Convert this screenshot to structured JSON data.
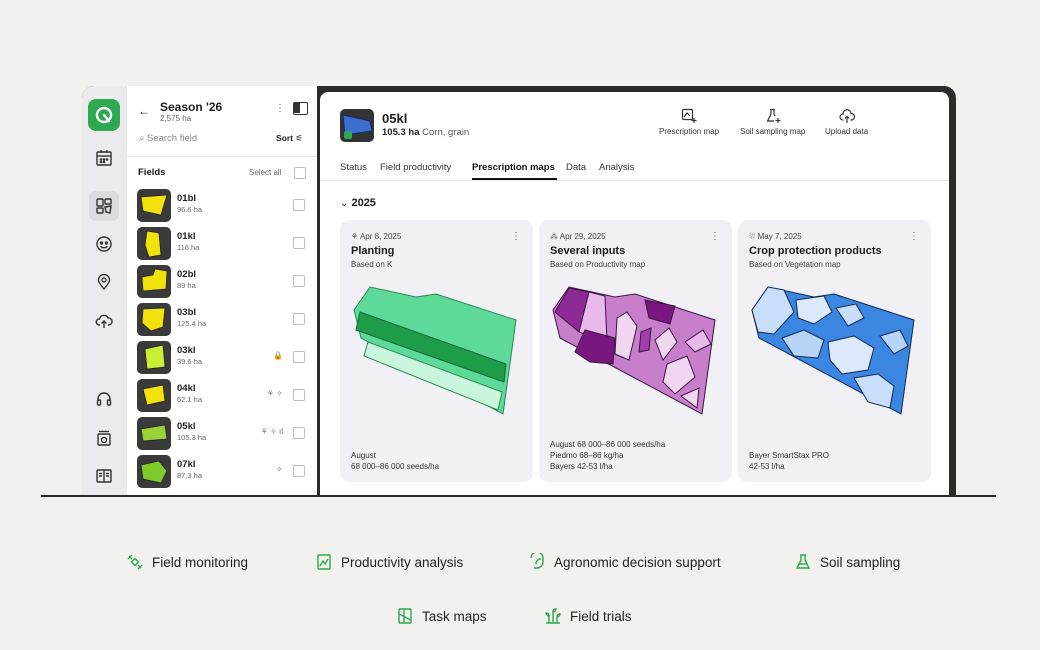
{
  "sidebar": {
    "season_title": "Season '26",
    "season_area": "2,575 ha",
    "search_placeholder": "Search field",
    "sort_label": "Sort",
    "fields_label": "Fields",
    "select_all_label": "Select all",
    "fields": [
      {
        "name": "01bl",
        "area": "96.6 ha",
        "tags": ""
      },
      {
        "name": "01kl",
        "area": "116 ha",
        "tags": ""
      },
      {
        "name": "02bl",
        "area": "89 ha",
        "tags": ""
      },
      {
        "name": "03bl",
        "area": "125.4 ha",
        "tags": ""
      },
      {
        "name": "03kl",
        "area": "39.6 ha",
        "tags": "🔒"
      },
      {
        "name": "04kl",
        "area": "62.1 ha",
        "tags": "⚘ ✧"
      },
      {
        "name": "05kl",
        "area": "105.3 ha",
        "tags": "⚘ ✧ ıl"
      },
      {
        "name": "07kl",
        "area": "87.3 ha",
        "tags": "✧"
      }
    ]
  },
  "field": {
    "name": "05kl",
    "area": "105.3 ha",
    "crop": "Corn, grain"
  },
  "actions": {
    "prescription_map": "Prescription map",
    "soil_sampling_map": "Soil sampling map",
    "upload_data": "Upload data"
  },
  "tabs": [
    "Status",
    "Field productivity",
    "Prescription maps",
    "Data",
    "Analysis"
  ],
  "year": "2025",
  "cards": [
    {
      "date": "Apr 8, 2025",
      "title": "Planting",
      "based_on": "Based on K",
      "foot1": "August",
      "foot2": "68 000–86 000 seeds/ha",
      "foot3": ""
    },
    {
      "date": "Apr 29, 2025",
      "title": "Several inputs",
      "based_on": "Based on Productivity map",
      "foot1": "August 68 000–86 000 seeds/ha",
      "foot2": "Piedmo 68–86 kg/ha",
      "foot3": "Bayers 42-53 l/ha"
    },
    {
      "date": "May 7, 2025",
      "title": "Crop protection products",
      "based_on": "Based on Vegetation map",
      "foot1": "Bayer SmartStax PRO",
      "foot2": "42-53 l/ha",
      "foot3": ""
    }
  ],
  "features": [
    {
      "label": "Field monitoring",
      "icon": "satellite-icon"
    },
    {
      "label": "Productivity analysis",
      "icon": "map-analysis-icon"
    },
    {
      "label": "Agronomic decision support",
      "icon": "leaf-hand-icon"
    },
    {
      "label": "Soil sampling",
      "icon": "flask-icon"
    },
    {
      "label": "Task maps",
      "icon": "task-map-icon"
    },
    {
      "label": "Field trials",
      "icon": "plant-trial-icon"
    }
  ],
  "colors": {
    "brand_green": "#2ea851",
    "accent": "#1e7d3a"
  }
}
